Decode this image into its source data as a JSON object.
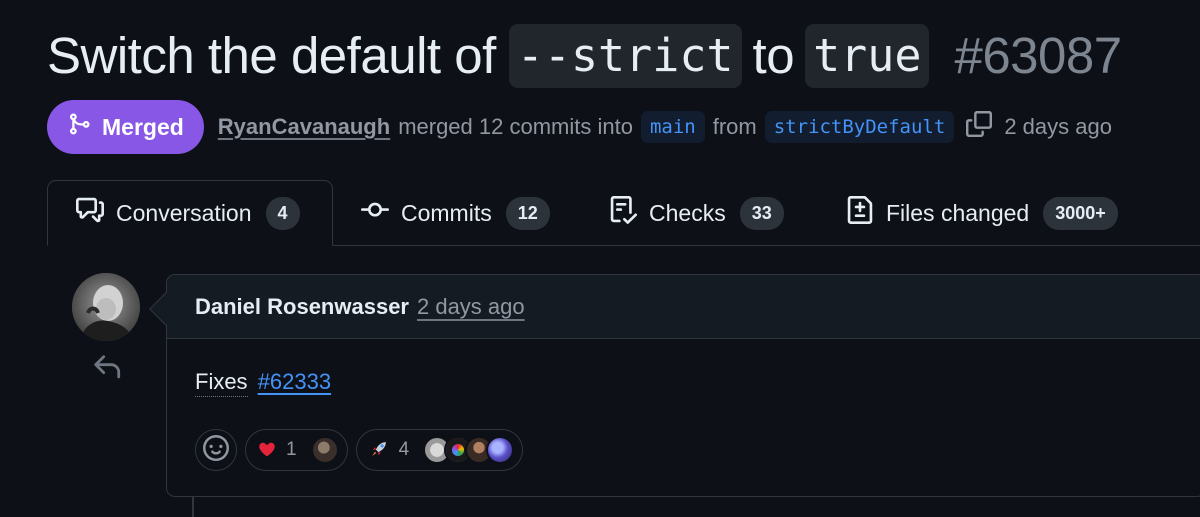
{
  "pr": {
    "title": "Switch the default of",
    "code1": "--strict",
    "title_mid": "to",
    "code2": "true",
    "number": "#63087"
  },
  "meta": {
    "state": "Merged",
    "author": "RyanCavanaugh",
    "text_merged": "merged 12 commits into",
    "base_branch": "main",
    "text_from": "from",
    "head_branch": "strictByDefault",
    "time": "2 days ago"
  },
  "tabs": [
    {
      "label": "Conversation",
      "count": "4",
      "icon": "comment-discussion-icon"
    },
    {
      "label": "Commits",
      "count": "12",
      "icon": "git-commit-icon"
    },
    {
      "label": "Checks",
      "count": "33",
      "icon": "checklist-icon"
    },
    {
      "label": "Files changed",
      "count": "3000+",
      "icon": "file-diff-icon"
    }
  ],
  "comment": {
    "author": "Daniel Rosenwasser",
    "time": "2 days ago",
    "body_text": "Fixes",
    "body_link": "#62333",
    "reactions": [
      {
        "emoji": "❤️",
        "count": "1",
        "icon": "heart-emoji"
      },
      {
        "emoji": "🚀",
        "count": "4",
        "icon": "rocket-emoji"
      }
    ]
  },
  "colors": {
    "background": "#0d1117",
    "merged_purple": "#8957e5",
    "link_blue": "#4493f8",
    "muted": "#9198a1",
    "border": "#30363d"
  }
}
